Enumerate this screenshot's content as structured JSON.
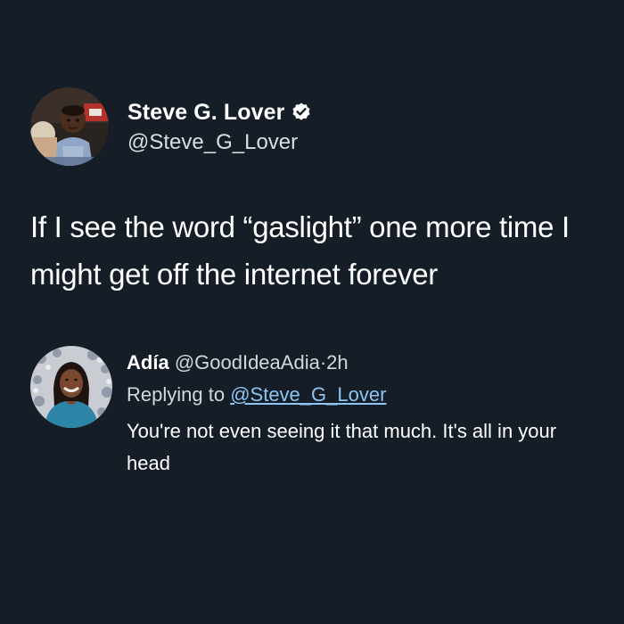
{
  "tweet": {
    "author": {
      "display_name": "Steve G. Lover",
      "handle": "@Steve_G_Lover",
      "avatar_icon": "child-portrait-avatar",
      "verified_icon": "verified-badge-icon"
    },
    "text": "If I see the word “gaslight” one more time I might get off the internet forever"
  },
  "reply": {
    "author": {
      "display_name": "Adía",
      "handle": "@GoodIdeaAdia",
      "avatar_icon": "woman-portrait-avatar"
    },
    "separator": "·",
    "time": "2h",
    "replying_prefix": "Replying to",
    "replying_to": "@Steve_G_Lover",
    "text": "You're not even seeing it that much. It's all in your head"
  },
  "colors": {
    "background": "#151d27",
    "primary_text": "#ffffff",
    "secondary_text": "#d2d8de",
    "link": "#8ec5f2"
  }
}
